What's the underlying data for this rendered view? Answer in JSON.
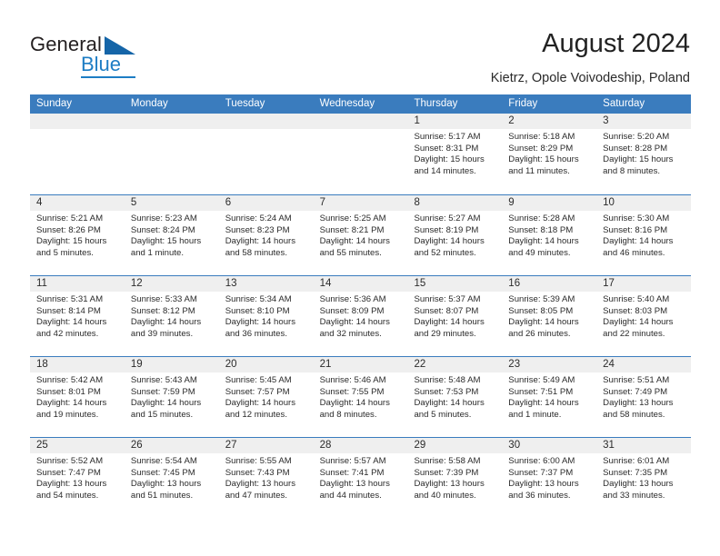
{
  "brand": {
    "name_part1": "General",
    "name_part2": "Blue",
    "triangle_icon": "triangle-icon",
    "accent_color": "#1d7dc4"
  },
  "header": {
    "title": "August 2024",
    "subtitle": "Kietrz, Opole Voivodeship, Poland"
  },
  "calendar": {
    "header_bg": "#3a7cbe",
    "cell_head_bg": "#efefef",
    "weekdays": [
      "Sunday",
      "Monday",
      "Tuesday",
      "Wednesday",
      "Thursday",
      "Friday",
      "Saturday"
    ],
    "weeks": [
      [
        {
          "day": "",
          "empty": true
        },
        {
          "day": "",
          "empty": true
        },
        {
          "day": "",
          "empty": true
        },
        {
          "day": "",
          "empty": true
        },
        {
          "day": "1",
          "sunrise": "Sunrise: 5:17 AM",
          "sunset": "Sunset: 8:31 PM",
          "daylight": "Daylight: 15 hours and 14 minutes."
        },
        {
          "day": "2",
          "sunrise": "Sunrise: 5:18 AM",
          "sunset": "Sunset: 8:29 PM",
          "daylight": "Daylight: 15 hours and 11 minutes."
        },
        {
          "day": "3",
          "sunrise": "Sunrise: 5:20 AM",
          "sunset": "Sunset: 8:28 PM",
          "daylight": "Daylight: 15 hours and 8 minutes."
        }
      ],
      [
        {
          "day": "4",
          "sunrise": "Sunrise: 5:21 AM",
          "sunset": "Sunset: 8:26 PM",
          "daylight": "Daylight: 15 hours and 5 minutes."
        },
        {
          "day": "5",
          "sunrise": "Sunrise: 5:23 AM",
          "sunset": "Sunset: 8:24 PM",
          "daylight": "Daylight: 15 hours and 1 minute."
        },
        {
          "day": "6",
          "sunrise": "Sunrise: 5:24 AM",
          "sunset": "Sunset: 8:23 PM",
          "daylight": "Daylight: 14 hours and 58 minutes."
        },
        {
          "day": "7",
          "sunrise": "Sunrise: 5:25 AM",
          "sunset": "Sunset: 8:21 PM",
          "daylight": "Daylight: 14 hours and 55 minutes."
        },
        {
          "day": "8",
          "sunrise": "Sunrise: 5:27 AM",
          "sunset": "Sunset: 8:19 PM",
          "daylight": "Daylight: 14 hours and 52 minutes."
        },
        {
          "day": "9",
          "sunrise": "Sunrise: 5:28 AM",
          "sunset": "Sunset: 8:18 PM",
          "daylight": "Daylight: 14 hours and 49 minutes."
        },
        {
          "day": "10",
          "sunrise": "Sunrise: 5:30 AM",
          "sunset": "Sunset: 8:16 PM",
          "daylight": "Daylight: 14 hours and 46 minutes."
        }
      ],
      [
        {
          "day": "11",
          "sunrise": "Sunrise: 5:31 AM",
          "sunset": "Sunset: 8:14 PM",
          "daylight": "Daylight: 14 hours and 42 minutes."
        },
        {
          "day": "12",
          "sunrise": "Sunrise: 5:33 AM",
          "sunset": "Sunset: 8:12 PM",
          "daylight": "Daylight: 14 hours and 39 minutes."
        },
        {
          "day": "13",
          "sunrise": "Sunrise: 5:34 AM",
          "sunset": "Sunset: 8:10 PM",
          "daylight": "Daylight: 14 hours and 36 minutes."
        },
        {
          "day": "14",
          "sunrise": "Sunrise: 5:36 AM",
          "sunset": "Sunset: 8:09 PM",
          "daylight": "Daylight: 14 hours and 32 minutes."
        },
        {
          "day": "15",
          "sunrise": "Sunrise: 5:37 AM",
          "sunset": "Sunset: 8:07 PM",
          "daylight": "Daylight: 14 hours and 29 minutes."
        },
        {
          "day": "16",
          "sunrise": "Sunrise: 5:39 AM",
          "sunset": "Sunset: 8:05 PM",
          "daylight": "Daylight: 14 hours and 26 minutes."
        },
        {
          "day": "17",
          "sunrise": "Sunrise: 5:40 AM",
          "sunset": "Sunset: 8:03 PM",
          "daylight": "Daylight: 14 hours and 22 minutes."
        }
      ],
      [
        {
          "day": "18",
          "sunrise": "Sunrise: 5:42 AM",
          "sunset": "Sunset: 8:01 PM",
          "daylight": "Daylight: 14 hours and 19 minutes."
        },
        {
          "day": "19",
          "sunrise": "Sunrise: 5:43 AM",
          "sunset": "Sunset: 7:59 PM",
          "daylight": "Daylight: 14 hours and 15 minutes."
        },
        {
          "day": "20",
          "sunrise": "Sunrise: 5:45 AM",
          "sunset": "Sunset: 7:57 PM",
          "daylight": "Daylight: 14 hours and 12 minutes."
        },
        {
          "day": "21",
          "sunrise": "Sunrise: 5:46 AM",
          "sunset": "Sunset: 7:55 PM",
          "daylight": "Daylight: 14 hours and 8 minutes."
        },
        {
          "day": "22",
          "sunrise": "Sunrise: 5:48 AM",
          "sunset": "Sunset: 7:53 PM",
          "daylight": "Daylight: 14 hours and 5 minutes."
        },
        {
          "day": "23",
          "sunrise": "Sunrise: 5:49 AM",
          "sunset": "Sunset: 7:51 PM",
          "daylight": "Daylight: 14 hours and 1 minute."
        },
        {
          "day": "24",
          "sunrise": "Sunrise: 5:51 AM",
          "sunset": "Sunset: 7:49 PM",
          "daylight": "Daylight: 13 hours and 58 minutes."
        }
      ],
      [
        {
          "day": "25",
          "sunrise": "Sunrise: 5:52 AM",
          "sunset": "Sunset: 7:47 PM",
          "daylight": "Daylight: 13 hours and 54 minutes."
        },
        {
          "day": "26",
          "sunrise": "Sunrise: 5:54 AM",
          "sunset": "Sunset: 7:45 PM",
          "daylight": "Daylight: 13 hours and 51 minutes."
        },
        {
          "day": "27",
          "sunrise": "Sunrise: 5:55 AM",
          "sunset": "Sunset: 7:43 PM",
          "daylight": "Daylight: 13 hours and 47 minutes."
        },
        {
          "day": "28",
          "sunrise": "Sunrise: 5:57 AM",
          "sunset": "Sunset: 7:41 PM",
          "daylight": "Daylight: 13 hours and 44 minutes."
        },
        {
          "day": "29",
          "sunrise": "Sunrise: 5:58 AM",
          "sunset": "Sunset: 7:39 PM",
          "daylight": "Daylight: 13 hours and 40 minutes."
        },
        {
          "day": "30",
          "sunrise": "Sunrise: 6:00 AM",
          "sunset": "Sunset: 7:37 PM",
          "daylight": "Daylight: 13 hours and 36 minutes."
        },
        {
          "day": "31",
          "sunrise": "Sunrise: 6:01 AM",
          "sunset": "Sunset: 7:35 PM",
          "daylight": "Daylight: 13 hours and 33 minutes."
        }
      ]
    ]
  }
}
